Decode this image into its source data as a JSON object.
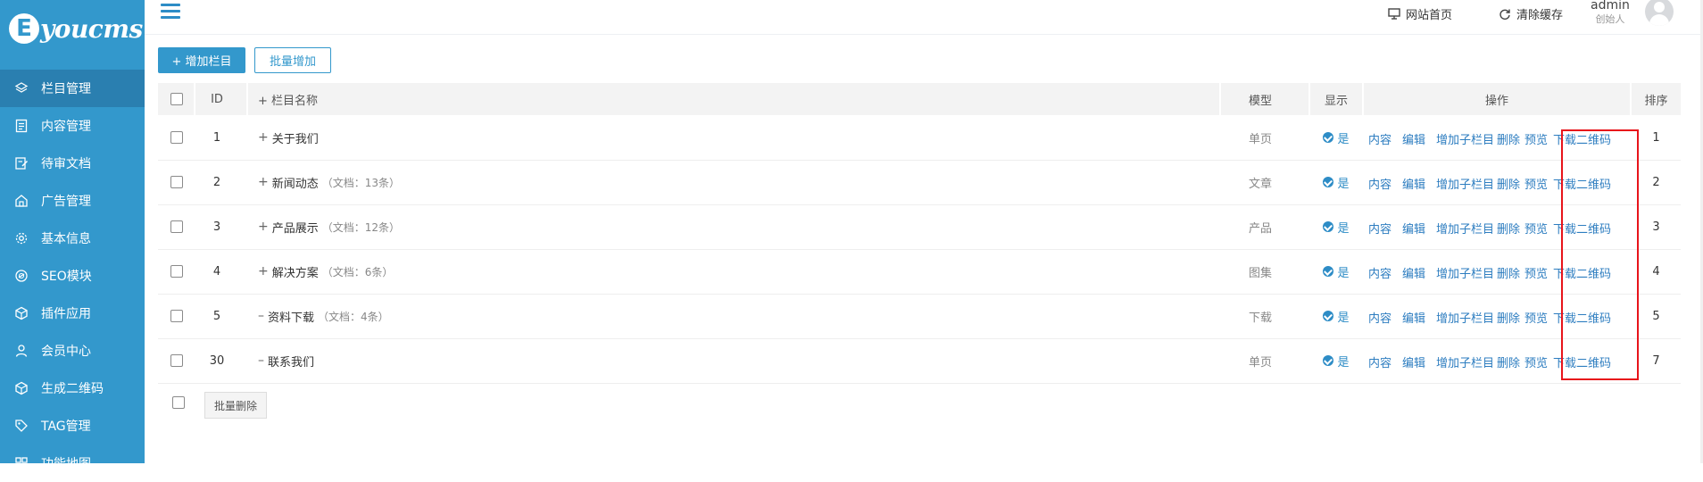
{
  "logo": {
    "mark": "E",
    "text": "youcms"
  },
  "sidebar": {
    "items": [
      {
        "label": "栏目管理",
        "icon": "layers-icon",
        "active": true
      },
      {
        "label": "内容管理",
        "icon": "document-icon"
      },
      {
        "label": "待审文档",
        "icon": "edit-document-icon"
      },
      {
        "label": "广告管理",
        "icon": "ad-icon"
      },
      {
        "label": "基本信息",
        "icon": "gear-icon"
      },
      {
        "label": "SEO模块",
        "icon": "seo-icon"
      },
      {
        "label": "插件应用",
        "icon": "cube-icon"
      },
      {
        "label": "会员中心",
        "icon": "user-icon"
      },
      {
        "label": "生成二维码",
        "icon": "cube-icon"
      },
      {
        "label": "TAG管理",
        "icon": "tag-icon"
      },
      {
        "label": "功能地图",
        "icon": "grid-icon"
      }
    ]
  },
  "header": {
    "site_home": "网站首页",
    "clear_cache": "清除缓存",
    "user_name": "admin",
    "user_role": "创始人"
  },
  "toolbar": {
    "add_label": "+ 增加栏目",
    "batch_add_label": "批量增加"
  },
  "table": {
    "columns": {
      "id": "ID",
      "name": "+ 栏目名称",
      "model": "模型",
      "display": "显示",
      "actions": "操作",
      "sort": "排序"
    },
    "actions": [
      "内容",
      "编辑",
      "增加子栏目",
      "删除",
      "预览",
      "下载二维码"
    ],
    "rows": [
      {
        "id": "1",
        "prefix": "+",
        "name": "关于我们",
        "count": "",
        "model": "单页",
        "display": "是",
        "sort": "1"
      },
      {
        "id": "2",
        "prefix": "+",
        "name": "新闻动态",
        "count": "（文档：13条）",
        "model": "文章",
        "display": "是",
        "sort": "2"
      },
      {
        "id": "3",
        "prefix": "+",
        "name": "产品展示",
        "count": "（文档：12条）",
        "model": "产品",
        "display": "是",
        "sort": "3"
      },
      {
        "id": "4",
        "prefix": "+",
        "name": "解决方案",
        "count": "（文档：6条）",
        "model": "图集",
        "display": "是",
        "sort": "4"
      },
      {
        "id": "5",
        "prefix": "–",
        "name": "资料下载",
        "count": "（文档：4条）",
        "model": "下载",
        "display": "是",
        "sort": "5"
      },
      {
        "id": "30",
        "prefix": "–",
        "name": "联系我们",
        "count": "",
        "model": "单页",
        "display": "是",
        "sort": "7"
      }
    ],
    "batch_delete_label": "批量删除"
  },
  "colors": {
    "sidebar": "#3398cc",
    "sidebar_active": "#2a7fb0",
    "link": "#2d7dc0",
    "highlight_box": "#e8141b"
  }
}
